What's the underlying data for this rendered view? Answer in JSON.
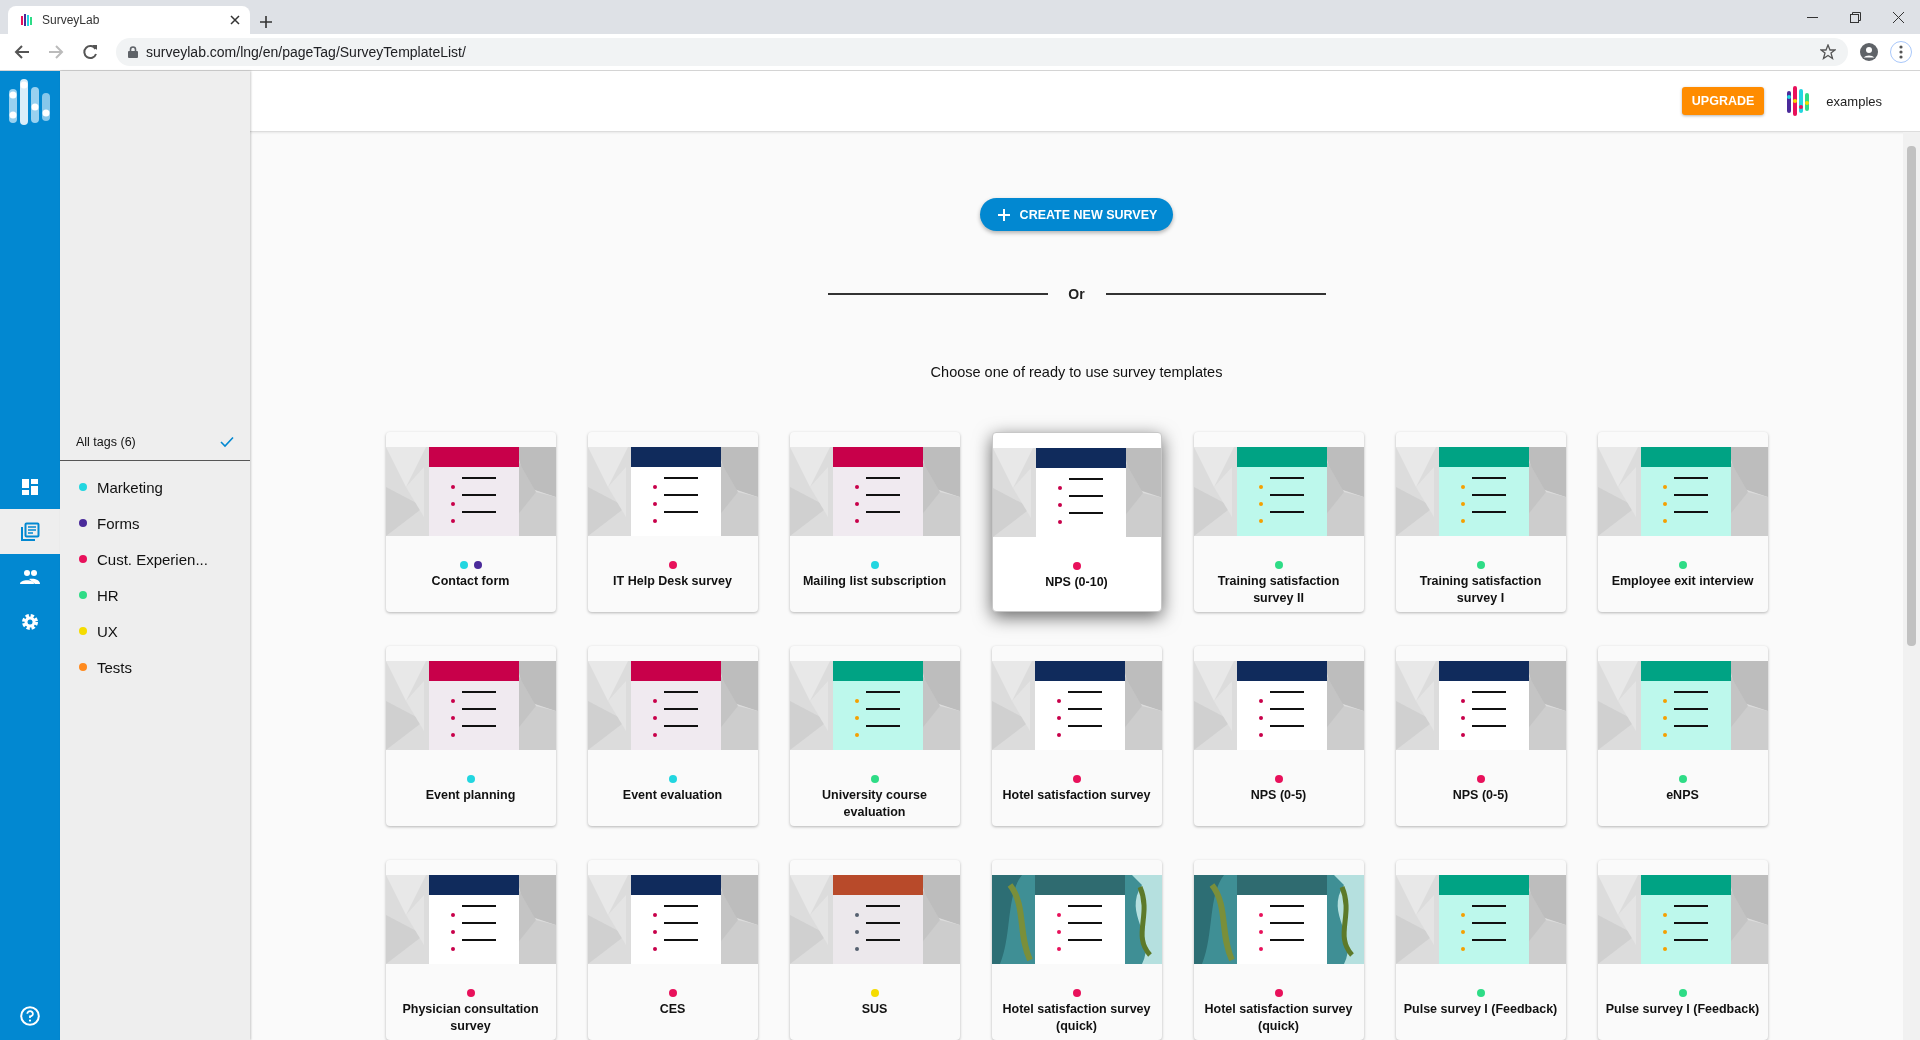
{
  "browser": {
    "tab_title": "SurveyLab",
    "url": "surveylab.com/lng/en/pageTag/SurveyTemplateList/"
  },
  "rail": [
    {
      "kind": "dashboard",
      "selected": false
    },
    {
      "kind": "surveys",
      "selected": true
    },
    {
      "kind": "contacts",
      "selected": false
    },
    {
      "kind": "settings",
      "selected": false
    }
  ],
  "tag_panel": {
    "all_tags": {
      "label": "All tags (6)",
      "checked": true
    },
    "tags": [
      {
        "label": "Marketing",
        "color": "#22d6e0"
      },
      {
        "label": "Forms",
        "color": "#4a2a9a"
      },
      {
        "label": "Cust. Experien...",
        "color": "#e8115b"
      },
      {
        "label": "HR",
        "color": "#2edc86"
      },
      {
        "label": "UX",
        "color": "#f5dc00"
      },
      {
        "label": "Tests",
        "color": "#ff8a1e"
      }
    ]
  },
  "header": {
    "upgrade_button": "UPGRADE",
    "account": "examples"
  },
  "create_button": "CREATE NEW SURVEY",
  "divider_text": "Or",
  "prompt": "Choose one of ready to use survey templates",
  "templates": [
    {
      "title": "Contact form",
      "tags": [
        {
          "color": "#22d6e0"
        },
        {
          "color": "#4a2a9a"
        }
      ],
      "kind": "crimson",
      "highlighted": false
    },
    {
      "title": "IT Help Desk survey",
      "tags": [
        {
          "color": "#e8115b"
        }
      ],
      "kind": "navy",
      "highlighted": false
    },
    {
      "title": "Mailing list subscription",
      "tags": [
        {
          "color": "#22d6e0"
        }
      ],
      "kind": "crimson",
      "highlighted": false
    },
    {
      "title": "NPS (0-10)",
      "tags": [
        {
          "color": "#e8115b"
        }
      ],
      "kind": "navy",
      "highlighted": true
    },
    {
      "title": "Training satisfaction survey II",
      "tags": [
        {
          "color": "#2edc86"
        }
      ],
      "kind": "teal",
      "highlighted": false
    },
    {
      "title": "Training satisfaction survey I",
      "tags": [
        {
          "color": "#2edc86"
        }
      ],
      "kind": "teal",
      "highlighted": false
    },
    {
      "title": "Employee exit interview",
      "tags": [
        {
          "color": "#2edc86"
        }
      ],
      "kind": "teal",
      "highlighted": false
    },
    {
      "title": "Event planning",
      "tags": [
        {
          "color": "#22d6e0"
        }
      ],
      "kind": "crimson",
      "highlighted": false
    },
    {
      "title": "Event evaluation",
      "tags": [
        {
          "color": "#22d6e0"
        }
      ],
      "kind": "crimson",
      "highlighted": false
    },
    {
      "title": "University course evaluation",
      "tags": [
        {
          "color": "#2edc86"
        }
      ],
      "kind": "teal",
      "highlighted": false
    },
    {
      "title": "Hotel satisfaction survey",
      "tags": [
        {
          "color": "#e8115b"
        }
      ],
      "kind": "navy",
      "highlighted": false
    },
    {
      "title": "NPS (0-5)",
      "tags": [
        {
          "color": "#e8115b"
        }
      ],
      "kind": "navy",
      "highlighted": false
    },
    {
      "title": "NPS (0-5)",
      "tags": [
        {
          "color": "#e8115b"
        }
      ],
      "kind": "navy",
      "highlighted": false
    },
    {
      "title": "eNPS",
      "tags": [
        {
          "color": "#2edc86"
        }
      ],
      "kind": "teal",
      "highlighted": false
    },
    {
      "title": "Physician consultation survey",
      "tags": [
        {
          "color": "#e8115b"
        }
      ],
      "kind": "navy",
      "highlighted": false
    },
    {
      "title": "CES",
      "tags": [
        {
          "color": "#e8115b"
        }
      ],
      "kind": "navy",
      "highlighted": false
    },
    {
      "title": "SUS",
      "tags": [
        {
          "color": "#f5dc00"
        }
      ],
      "kind": "rust",
      "highlighted": false
    },
    {
      "title": "Hotel satisfaction survey (quick)",
      "tags": [
        {
          "color": "#e8115b"
        }
      ],
      "kind": "lagoon",
      "highlighted": false
    },
    {
      "title": "Hotel satisfaction survey (quick)",
      "tags": [
        {
          "color": "#e8115b"
        }
      ],
      "kind": "lagoon",
      "highlighted": false
    },
    {
      "title": "Pulse survey I (Feedback)",
      "tags": [
        {
          "color": "#2edc86"
        }
      ],
      "kind": "teal",
      "highlighted": false
    },
    {
      "title": "Pulse survey I (Feedback)",
      "tags": [
        {
          "color": "#2edc86"
        }
      ],
      "kind": "teal",
      "highlighted": false
    }
  ]
}
